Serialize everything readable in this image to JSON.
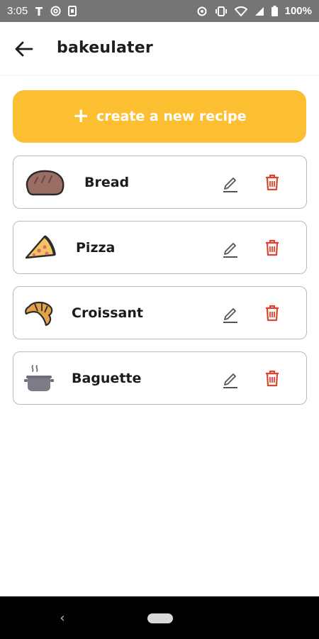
{
  "status_bar": {
    "time": "3:05",
    "battery": "100%",
    "icons_left": [
      "T-icon",
      "at-sign-icon",
      "sim-card-icon"
    ],
    "icons_right": [
      "location-icon",
      "vibrate-icon",
      "wifi-icon",
      "signal-icon",
      "battery-icon"
    ]
  },
  "app_bar": {
    "title": "bakeulater",
    "back_icon": "arrow-left-icon"
  },
  "create_button": {
    "plus": "+",
    "label": "create a new recipe"
  },
  "recipes": [
    {
      "name": "Bread",
      "icon": "bread-icon"
    },
    {
      "name": "Pizza",
      "icon": "pizza-icon"
    },
    {
      "name": "Croissant",
      "icon": "croissant-icon"
    },
    {
      "name": "Baguette",
      "icon": "pot-icon"
    }
  ],
  "colors": {
    "accent": "#fcbf32",
    "delete": "#e0432f",
    "edit": "#555555",
    "card_border": "#b9b9b9"
  },
  "nav_bar": {
    "back_glyph": "‹"
  }
}
